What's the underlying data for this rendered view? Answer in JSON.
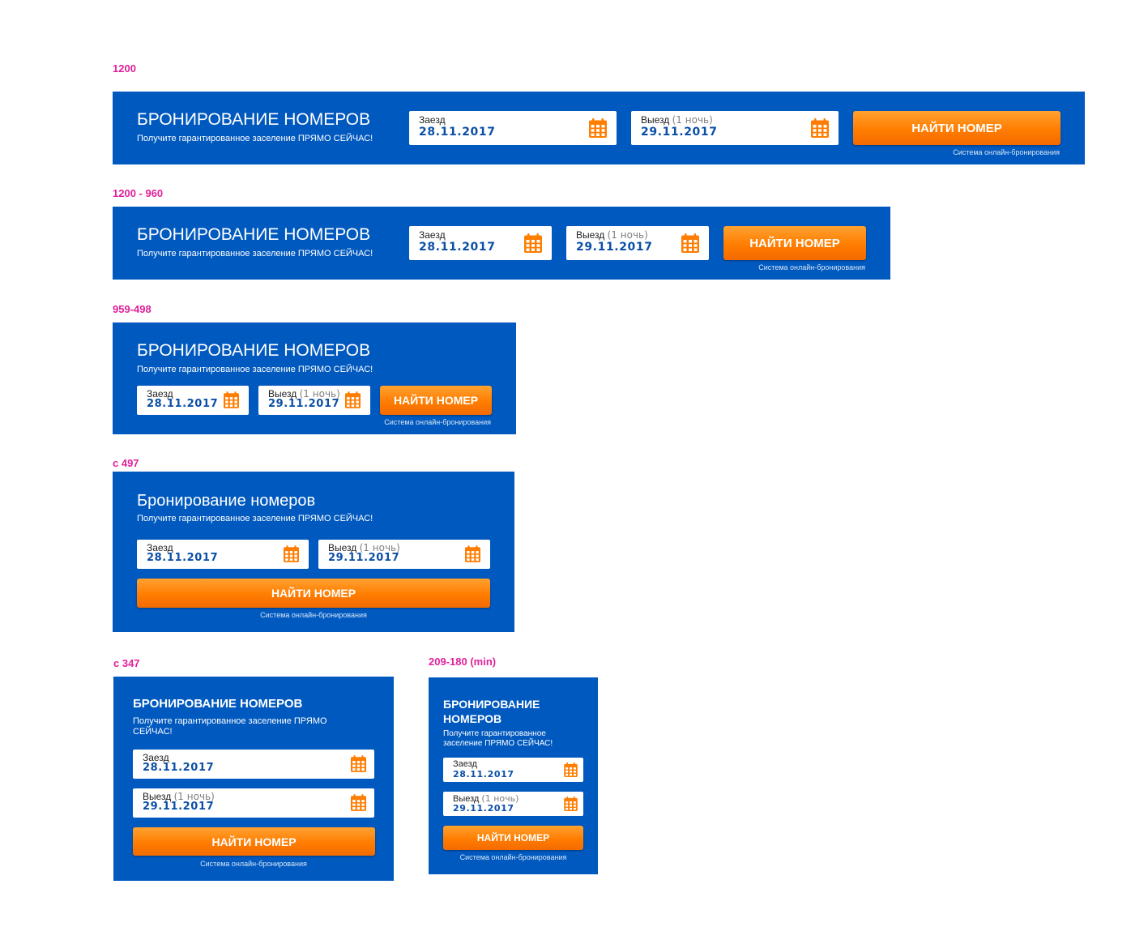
{
  "breakpoint_labels": [
    "1200",
    "1200 - 960",
    "959-498",
    "с 497",
    "с 347",
    "209-180 (min)"
  ],
  "colors": {
    "widget_bg": "#0059bf",
    "button_orange": "#ff7d00",
    "calendar_icon": "#ff7d00",
    "label_pink": "#e0219a",
    "date_blue": "#0b4fa6"
  },
  "widget": {
    "title_upper": "БРОНИРОВАНИЕ НОМЕРОВ",
    "title_mixed": "Бронирование номеров",
    "subtitle": "Получите гарантированное заселение ПРЯМО СЕЙЧАС!",
    "checkin_label": "Заезд",
    "checkin_date": "28.11.2017",
    "checkout_label": "Выезд",
    "nights": "(1 ночь)",
    "checkout_date": "29.11.2017",
    "calendar_icon": "calendar-icon",
    "button_label": "НАЙТИ НОМЕР",
    "footer": "Система онлайн-бронирования"
  }
}
